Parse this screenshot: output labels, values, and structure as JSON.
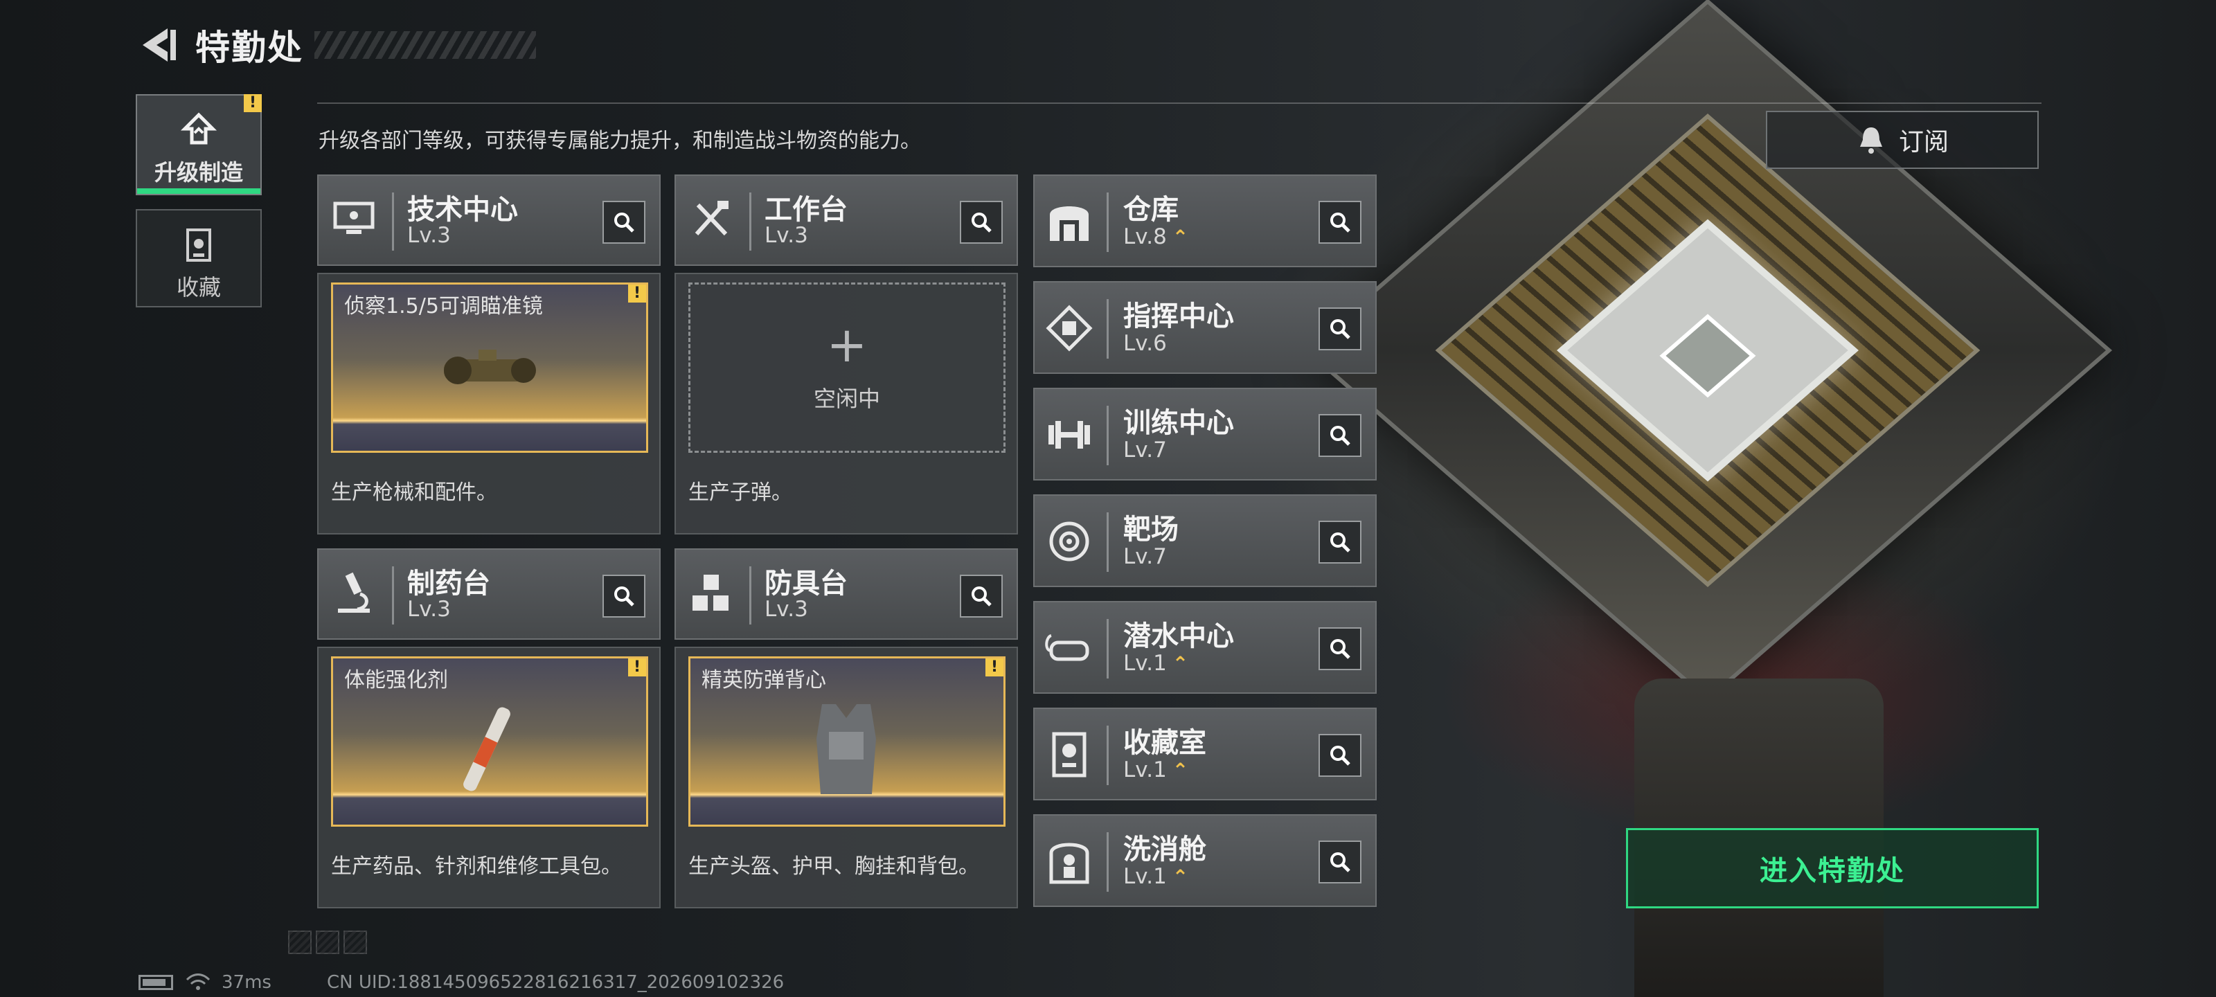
{
  "header": {
    "title": "特勤处"
  },
  "side_tabs": [
    {
      "label": "升级制造",
      "active": true,
      "alert": "!"
    },
    {
      "label": "收藏",
      "active": false
    }
  ],
  "description": "升级各部门等级，可获得专属能力提升，和制造战斗物资的能力。",
  "subscribe_label": "订阅",
  "workshops": [
    {
      "name": "技术中心",
      "level": "Lv.3",
      "icon": "monitor-icon",
      "product": "侦察1.5/5可调瞄准镜",
      "product_alert": "!",
      "footer": "生产枪械和配件。"
    },
    {
      "name": "工作台",
      "level": "Lv.3",
      "icon": "tools-icon",
      "idle_label": "空闲中",
      "footer": "生产子弹。"
    },
    {
      "name": "制药台",
      "level": "Lv.3",
      "icon": "microscope-icon",
      "product": "体能强化剂",
      "product_alert": "!",
      "footer": "生产药品、针剂和维修工具包。"
    },
    {
      "name": "防具台",
      "level": "Lv.3",
      "icon": "cubes-icon",
      "product": "精英防弹背心",
      "product_alert": "!",
      "footer": "生产头盔、护甲、胸挂和背包。"
    }
  ],
  "buildings": [
    {
      "name": "仓库",
      "level": "Lv.8",
      "upgradable": true,
      "icon": "warehouse-icon"
    },
    {
      "name": "指挥中心",
      "level": "Lv.6",
      "upgradable": false,
      "icon": "chip-icon"
    },
    {
      "name": "训练中心",
      "level": "Lv.7",
      "upgradable": false,
      "icon": "dumbbell-icon"
    },
    {
      "name": "靶场",
      "level": "Lv.7",
      "upgradable": false,
      "icon": "target-icon"
    },
    {
      "name": "潜水中心",
      "level": "Lv.1",
      "upgradable": true,
      "icon": "goggles-icon"
    },
    {
      "name": "收藏室",
      "level": "Lv.1",
      "upgradable": true,
      "icon": "display-case-icon"
    },
    {
      "name": "洗消舱",
      "level": "Lv.1",
      "upgradable": true,
      "icon": "decon-icon"
    }
  ],
  "upgrade_glyph": "⌃",
  "enter_button": "进入特勤处",
  "status_bar": {
    "ping": "37ms",
    "uid": "CN UID:18814509652281621631​7_202609102326"
  },
  "colors": {
    "accent_green": "#2fd882",
    "alert_yellow": "#f3c94a",
    "gold_border": "#e6b857"
  }
}
